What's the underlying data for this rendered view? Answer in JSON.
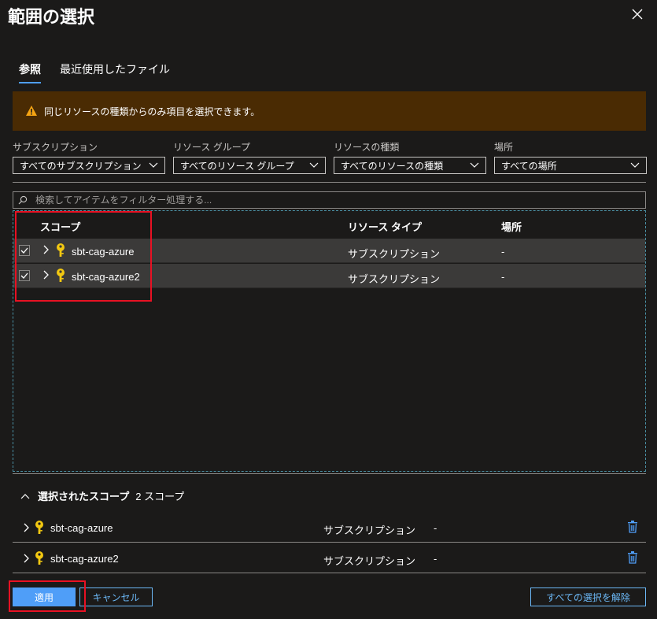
{
  "dialog": {
    "title": "範囲の選択"
  },
  "tabs": [
    {
      "label": "参照",
      "active": true
    },
    {
      "label": "最近使用したファイル",
      "active": false
    }
  ],
  "warning": {
    "text": "同じリソースの種類からのみ項目を選択できます。"
  },
  "filters": [
    {
      "label": "サブスクリプション",
      "value": "すべてのサブスクリプション"
    },
    {
      "label": "リソース グループ",
      "value": "すべてのリソース グループ"
    },
    {
      "label": "リソースの種類",
      "value": "すべてのリソースの種類"
    },
    {
      "label": "場所",
      "value": "すべての場所"
    }
  ],
  "search": {
    "placeholder": "検索してアイテムをフィルター処理する..."
  },
  "grid": {
    "columns": {
      "scope": "スコープ",
      "type": "リソース タイプ",
      "location": "場所"
    },
    "rows": [
      {
        "name": "sbt-cag-azure",
        "type": "サブスクリプション",
        "location": "-",
        "checked": true
      },
      {
        "name": "sbt-cag-azure2",
        "type": "サブスクリプション",
        "location": "-",
        "checked": true
      }
    ]
  },
  "selected": {
    "title": "選択されたスコープ",
    "count": "2 スコープ",
    "items": [
      {
        "name": "sbt-cag-azure",
        "type": "サブスクリプション",
        "location": "-"
      },
      {
        "name": "sbt-cag-azure2",
        "type": "サブスクリプション",
        "location": "-"
      }
    ]
  },
  "buttons": {
    "apply": "適用",
    "cancel": "キャンセル",
    "clear_all": "すべての選択を解除"
  },
  "colors": {
    "background": "#1b1a19",
    "accent": "#4f9ef8",
    "warning_bg": "#4a2b03",
    "warning_icon": "#f7a513",
    "key_icon": "#f2c811",
    "row_selected": "#3b3a39",
    "highlight": "#e81123"
  }
}
